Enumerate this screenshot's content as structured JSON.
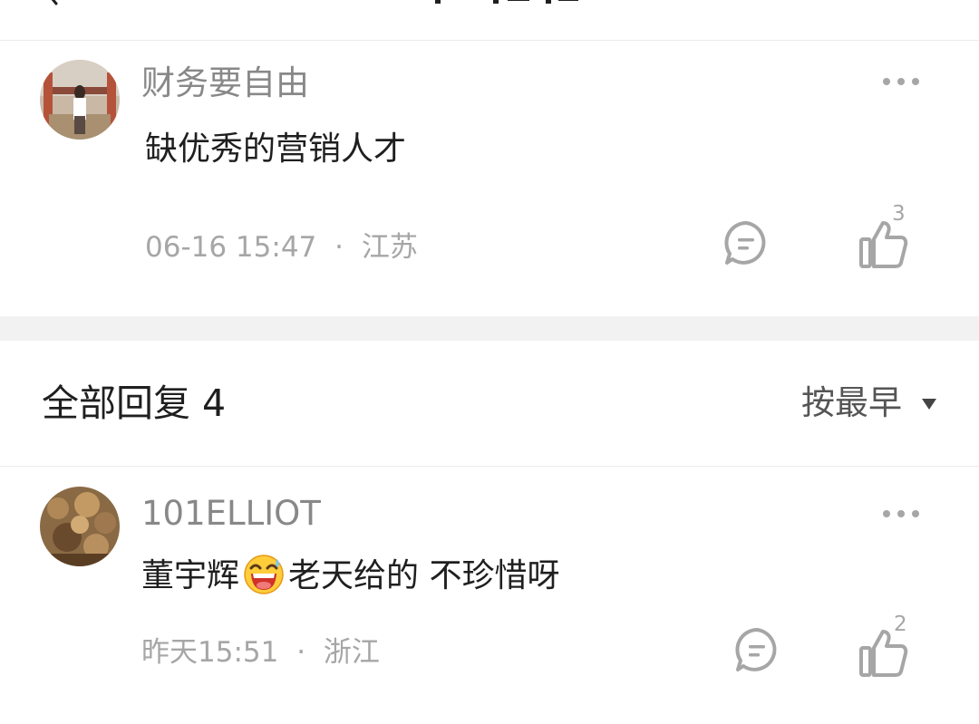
{
  "comments": [
    {
      "username": "财务要自由",
      "content": "缺优秀的营销人才",
      "time": "06-16 15:47",
      "separator": "·",
      "location": "江苏",
      "like_count": "3"
    }
  ],
  "replies_section": {
    "title": "全部回复 4",
    "sort_label": "按最早"
  },
  "replies": [
    {
      "username": "101ELLIOT",
      "content_before": "董宇辉",
      "emoji": "grinning-sweat-emoji",
      "content_after": "老天给的 不珍惜呀",
      "time": "昨天15:51",
      "separator": "·",
      "location": "浙江",
      "like_count": "2"
    }
  ],
  "colors": {
    "meta_gray": "#a6a6a6",
    "username_gray": "#888888",
    "text_dark": "#1f1f1f",
    "divider_gray": "#f2f2f2"
  },
  "icons": [
    "back-arrow-icon",
    "more-dots-icon",
    "reply-bubble-icon",
    "thumbs-up-icon",
    "sort-down-triangle-icon",
    "grinning-sweat-emoji"
  ]
}
